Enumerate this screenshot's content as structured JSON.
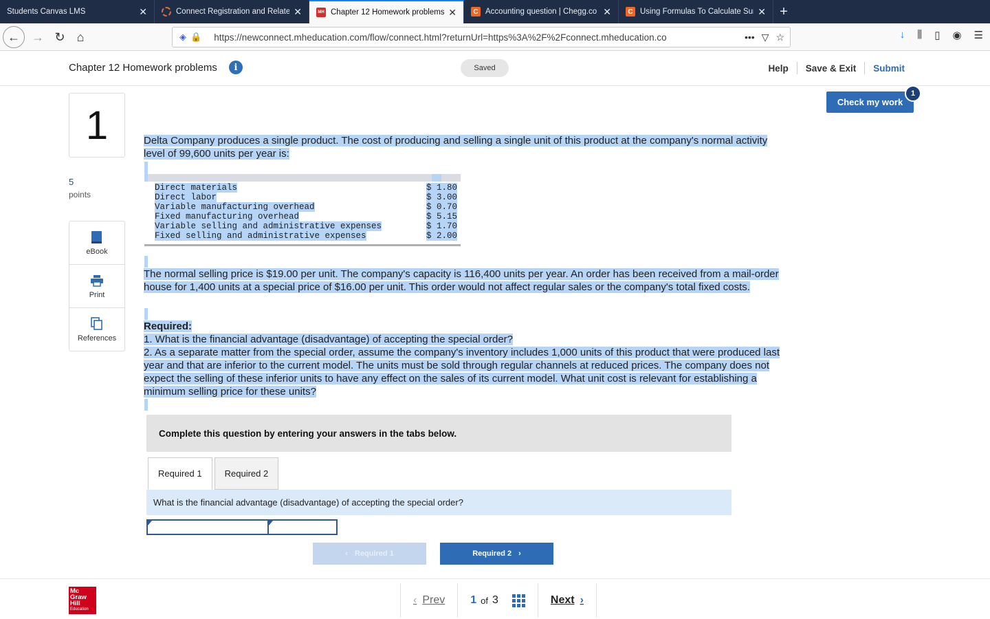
{
  "browser": {
    "tabs": [
      {
        "label": "Students Canvas LMS",
        "active": false
      },
      {
        "label": "Connect Registration and Relate",
        "active": false
      },
      {
        "label": "Chapter 12 Homework problems",
        "active": true
      },
      {
        "label": "Accounting question | Chegg.co",
        "active": false
      },
      {
        "label": "Using Formulas To Calculate Sur",
        "active": false
      }
    ],
    "url": "https://newconnect.mheducation.com/flow/connect.html?returnUrl=https%3A%2F%2Fconnect.mheducation.co"
  },
  "header": {
    "title": "Chapter 12 Homework problems",
    "saved": "Saved",
    "help": "Help",
    "save_exit": "Save & Exit",
    "submit": "Submit",
    "check_work": "Check my work",
    "check_badge": "1"
  },
  "question": {
    "number": "1",
    "points_value": "5",
    "points_label": "points",
    "tools": [
      "eBook",
      "Print",
      "References"
    ],
    "intro": "Delta Company produces a single product. The cost of producing and selling a single unit of this product at the company's normal activity level of 99,600 units per year is:",
    "costs": [
      {
        "name": "Direct materials",
        "value": "$ 1.80"
      },
      {
        "name": "Direct labor",
        "value": "$ 3.00"
      },
      {
        "name": "Variable manufacturing overhead",
        "value": "$ 0.70"
      },
      {
        "name": "Fixed manufacturing overhead",
        "value": "$ 5.15"
      },
      {
        "name": "Variable selling and administrative expenses",
        "value": "$ 1.70"
      },
      {
        "name": "Fixed selling and administrative expenses",
        "value": "$ 2.00"
      }
    ],
    "body": "The normal selling price is $19.00 per unit. The company's capacity is 116,400 units per year. An order has been received from a mail-order house for 1,400 units at a special price of $16.00 per unit. This order would not affect regular sales or the company's total fixed costs.",
    "required_heading": "Required:",
    "required_1": "1. What is the financial advantage (disadvantage) of accepting the special order?",
    "required_2": "2. As a separate matter from the special order, assume the company's inventory includes 1,000 units of this product that were produced last year and that are inferior to the current model. The units must be sold through regular channels at reduced prices. The company does not expect the selling of these inferior units to have any effect on the sales of its current model. What unit cost is relevant for establishing a minimum selling price for these units?",
    "instruction": "Complete this question by entering your answers in the tabs below.",
    "tabs": [
      "Required 1",
      "Required 2"
    ],
    "prompt": "What is the financial advantage (disadvantage) of accepting the special order?",
    "prev_req": "Required 1",
    "next_req": "Required 2"
  },
  "footer": {
    "logo_line1": "Mc",
    "logo_line2": "Graw",
    "logo_line3": "Hill",
    "logo_line4": "Education",
    "prev": "Prev",
    "current": "1",
    "of": "of",
    "total": "3",
    "next": "Next"
  }
}
